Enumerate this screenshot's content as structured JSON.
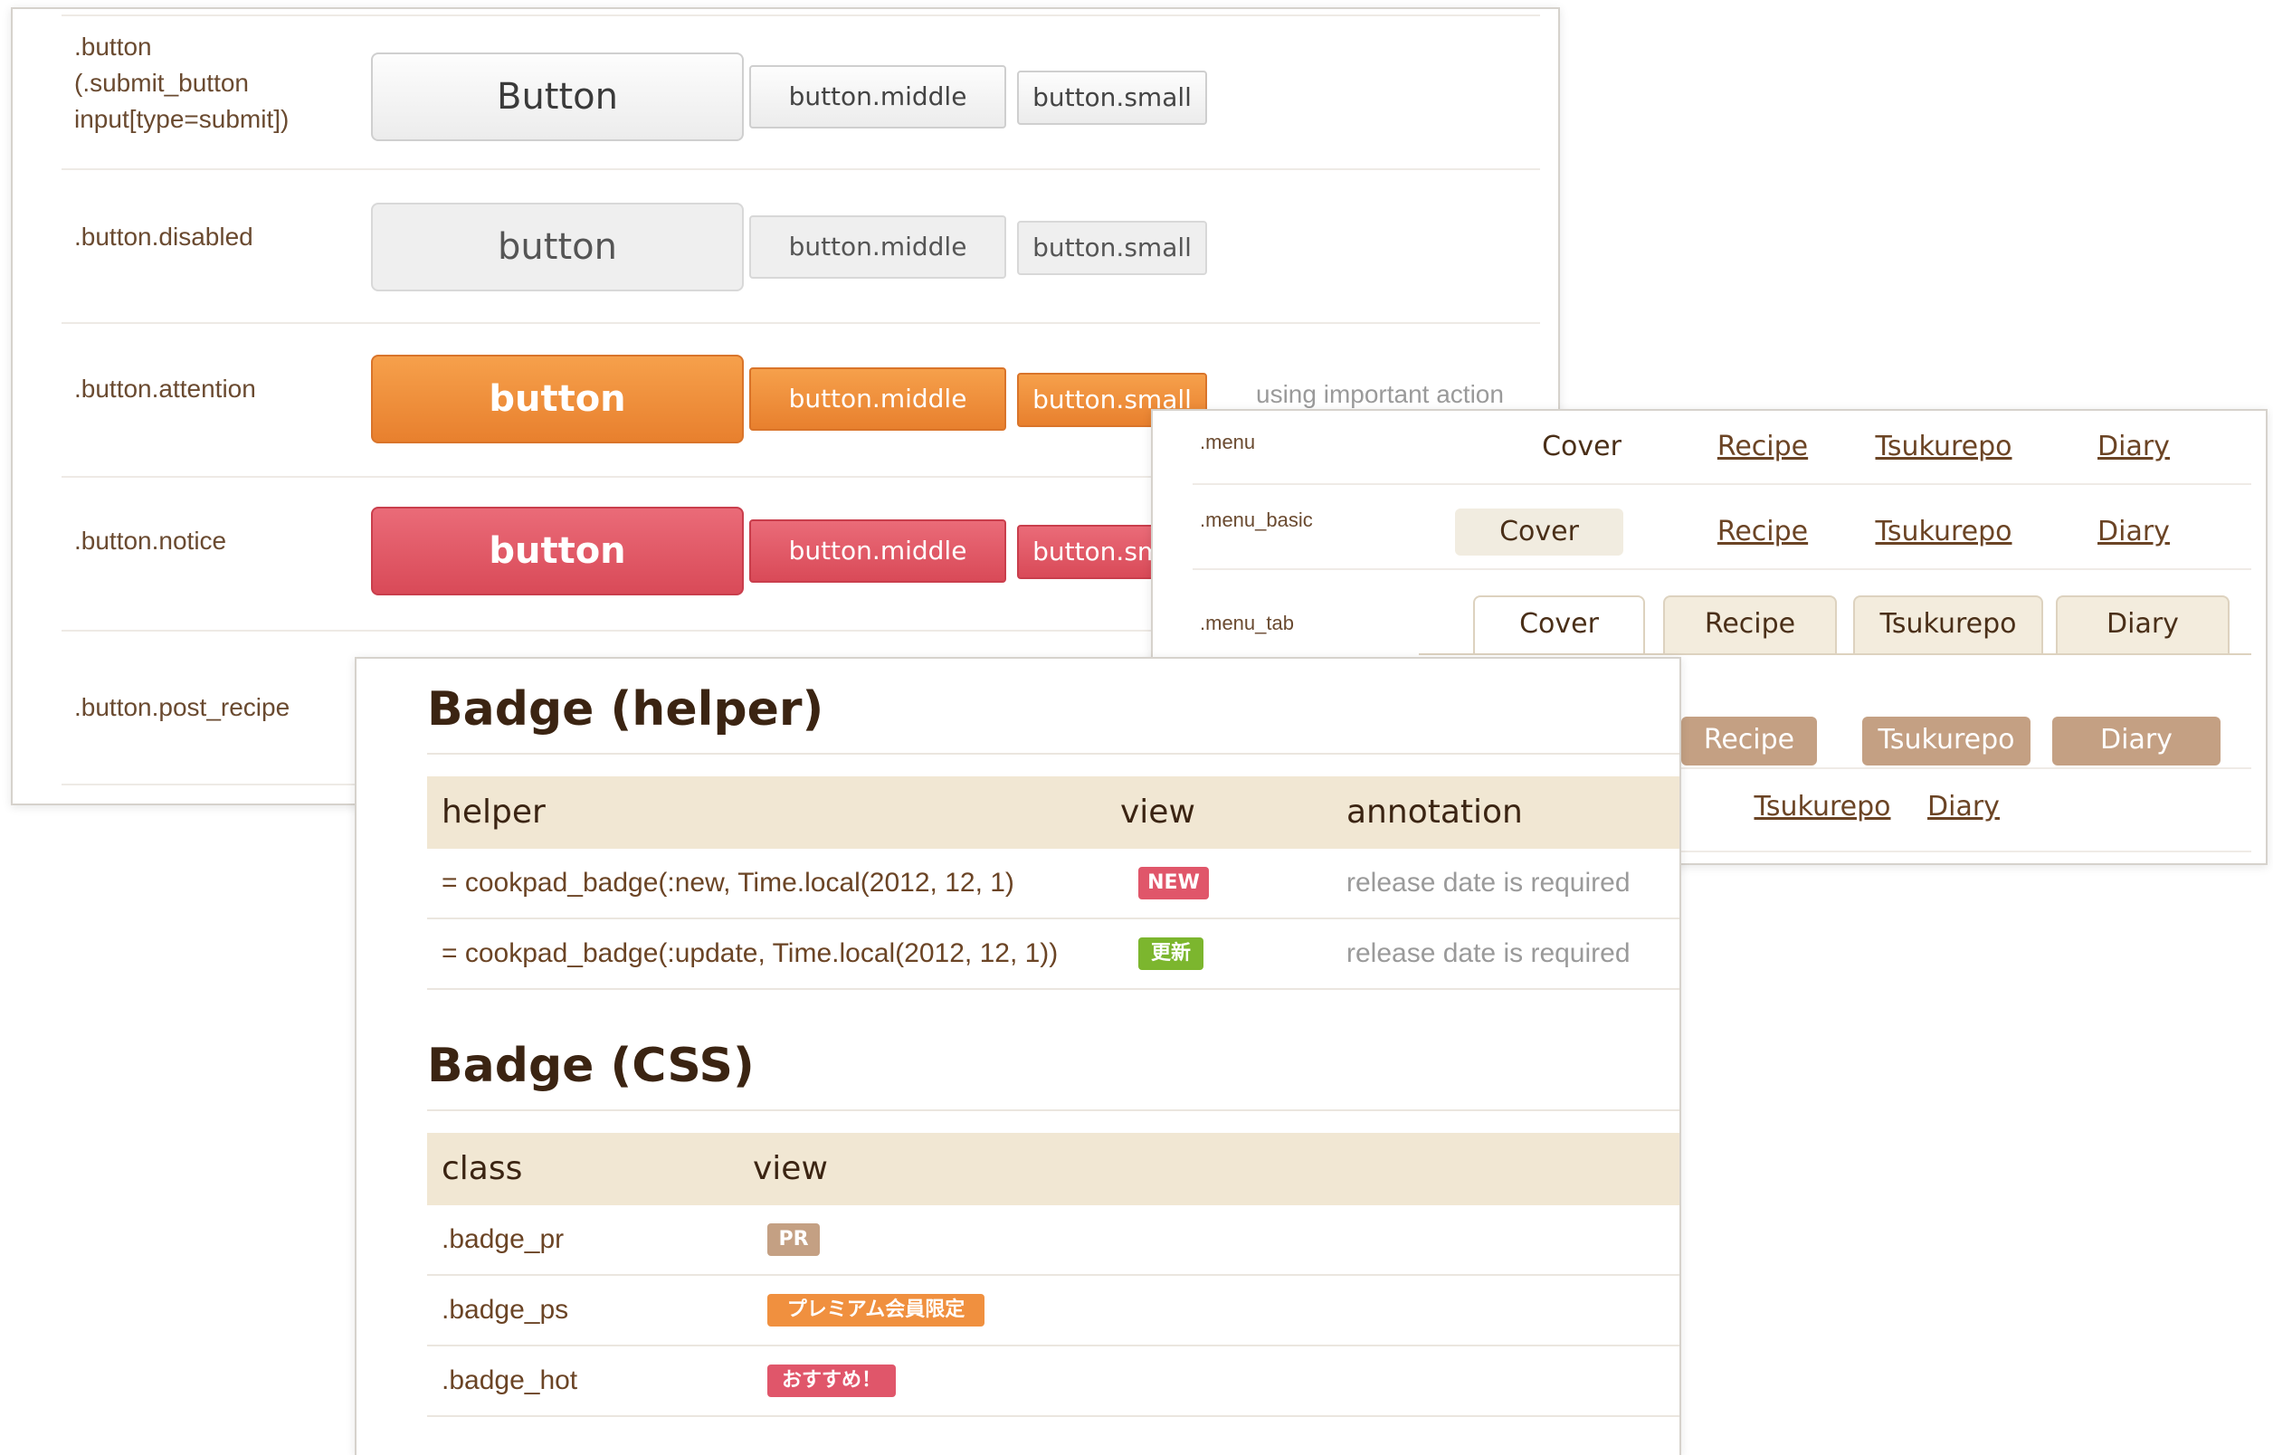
{
  "buttons_panel": {
    "rows": [
      {
        "class_lines": [
          ".button",
          "(.submit_button",
          "input[type=submit])"
        ],
        "large": "Button",
        "middle": "button.middle",
        "small": "button.small"
      },
      {
        "class_lines": [
          ".button.disabled"
        ],
        "large": "button",
        "middle": "button.middle",
        "small": "button.small"
      },
      {
        "class_lines": [
          ".button.attention"
        ],
        "large": "button",
        "middle": "button.middle",
        "small": "button.small",
        "note": "using important action"
      },
      {
        "class_lines": [
          ".button.notice"
        ],
        "large": "button",
        "middle": "button.middle",
        "small": "button.small"
      },
      {
        "class_lines": [
          ".button.post_recipe"
        ]
      }
    ]
  },
  "menu_panel": {
    "rows": [
      {
        "class": ".menu",
        "items": [
          "Cover",
          "Recipe",
          "Tsukurepo",
          "Diary"
        ]
      },
      {
        "class": ".menu_basic",
        "items": [
          "Cover",
          "Recipe",
          "Tsukurepo",
          "Diary"
        ]
      },
      {
        "class": ".menu_tab",
        "items": [
          "Cover",
          "Recipe",
          "Tsukurepo",
          "Diary"
        ]
      },
      {
        "items": [
          "Recipe",
          "Tsukurepo",
          "Diary"
        ]
      },
      {
        "items": [
          "Tsukurepo",
          "Diary"
        ]
      }
    ]
  },
  "badge_panel": {
    "helper_title": "Badge (helper)",
    "helper_headers": [
      "helper",
      "view",
      "annotation"
    ],
    "helper_rows": [
      {
        "helper": "= cookpad_badge(:new, Time.local(2012, 12, 1)",
        "badge": "NEW",
        "badge_color": "#e0566a",
        "annotation": "release date is required"
      },
      {
        "helper": "= cookpad_badge(:update, Time.local(2012, 12, 1))",
        "badge": "更新",
        "badge_color": "#7cb62e",
        "annotation": "release date is required"
      }
    ],
    "css_title": "Badge (CSS)",
    "css_headers": [
      "class",
      "view"
    ],
    "css_rows": [
      {
        "class": ".badge_pr",
        "badge": "PR",
        "badge_color": "#c4a083"
      },
      {
        "class": ".badge_ps",
        "badge": "プレミアム会員限定",
        "badge_color": "#f0903f"
      },
      {
        "class": ".badge_hot",
        "badge": "おすすめ！",
        "badge_color": "#e0566a"
      }
    ]
  },
  "colors": {
    "accent_orange": "#e8802e",
    "notice_red": "#d94a58",
    "header_beige": "#f1e7d3",
    "text_brown": "#5a3d22"
  }
}
